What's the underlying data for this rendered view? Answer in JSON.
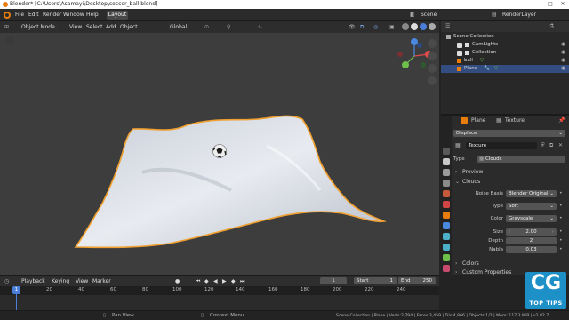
{
  "window": {
    "title": "Blender* [C:\\Users\\Asamayi\\Desktop\\soccer_ball.blend]",
    "controls": [
      "—",
      "□",
      "✕"
    ]
  },
  "menubar": {
    "items": [
      "File",
      "Edit",
      "Render",
      "Window",
      "Help"
    ],
    "active_tab": "Layout",
    "scene_label": "Scene",
    "render_layer_label": "RenderLayer"
  },
  "viewport": {
    "mode": "Object Mode",
    "menus": [
      "View",
      "Select",
      "Add",
      "Object"
    ],
    "transform_orientation": "Global"
  },
  "outliner": {
    "root": "Scene Collection",
    "rows": [
      {
        "label": "CamLights",
        "indent": 1
      },
      {
        "label": "Collection",
        "indent": 1
      },
      {
        "label": "ball",
        "indent": 1
      },
      {
        "label": "Plane",
        "indent": 1,
        "selected": true
      }
    ]
  },
  "properties": {
    "object_name": "Plane",
    "tab_name": "Texture",
    "modifier_dropdown": "Displace",
    "texture_name": "Texture",
    "type_label": "Type",
    "type_value": "Clouds",
    "sections": {
      "preview": "Preview",
      "clouds": "Clouds",
      "colors": "Colors",
      "custom_properties": "Custom Properties"
    },
    "fields": [
      {
        "label": "Noise Basis",
        "value": "Blender Original",
        "kind": "dropdown"
      },
      {
        "label": "Type",
        "value": "Soft",
        "kind": "dropdown"
      },
      {
        "label": "Color",
        "value": "Grayscale",
        "kind": "dropdown"
      },
      {
        "label": "Size",
        "value": "2.00",
        "kind": "number"
      },
      {
        "label": "Depth",
        "value": "2",
        "kind": "number"
      },
      {
        "label": "Nabla",
        "value": "0.03",
        "kind": "number"
      }
    ]
  },
  "timeline": {
    "menus": [
      "Playback",
      "Keying",
      "View",
      "Marker"
    ],
    "current_frame": "1",
    "start_label": "Start",
    "start_value": "1",
    "end_label": "End",
    "end_value": "250",
    "ticks": [
      "0",
      "20",
      "40",
      "60",
      "80",
      "100",
      "120",
      "140",
      "160",
      "180",
      "200",
      "220",
      "240"
    ],
    "cursor_label": "1"
  },
  "statusbar": {
    "left": "Pan View",
    "middle": "Context Menu",
    "right": "Scene Collection | Plane | Verts:2,794 | Faces:3,459 | Tris:4,866 | Objects:1/2 | Mem: 117.3 MiB | v2.82.7"
  },
  "logo": {
    "big": "CG",
    "small": "TOP TIPS"
  },
  "colors": {
    "accent_orange": "#e87d0d",
    "selection_blue": "#334d80",
    "logo_blue": "#1e90c8"
  }
}
